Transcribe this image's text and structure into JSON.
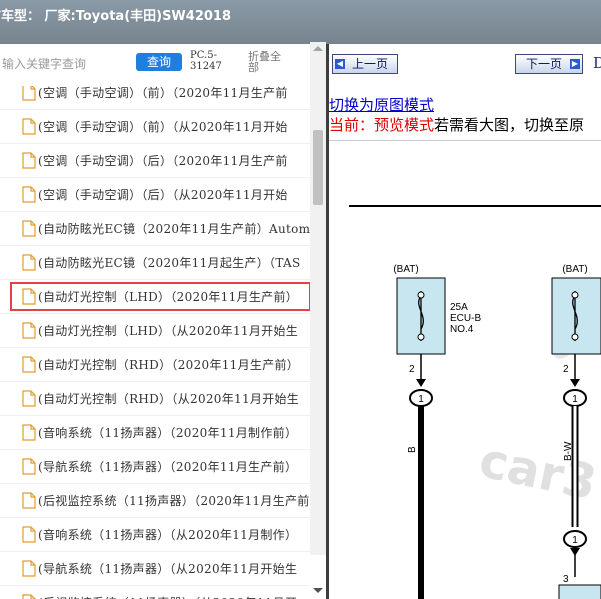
{
  "header": {
    "title": "前车型： 厂家:Toyota(丰田)SW42018"
  },
  "toolbar": {
    "search_placeholder": "输入关键字查询",
    "search_label": "查询",
    "pc_label": "PC.5-31247",
    "collapse_label": "折叠全部"
  },
  "tree": {
    "items": [
      {
        "label": "(空调（手动空调）（前）（2020年11月生产前"
      },
      {
        "label": "(空调（手动空调）（前）（从2020年11月开始"
      },
      {
        "label": "(空调（手动空调）（后）（2020年11月生产前"
      },
      {
        "label": "(空调（手动空调）（后）（从2020年11月开始"
      },
      {
        "label": "(自动防眩光EC镜（2020年11月生产前）Autom"
      },
      {
        "label": "(自动防眩光EC镜（2020年11月起生产）（TAS"
      },
      {
        "label": "(自动灯光控制（LHD）（2020年11月生产前）"
      },
      {
        "label": "(自动灯光控制（LHD）（从2020年11月开始生"
      },
      {
        "label": "(自动灯光控制（RHD）（2020年11月生产前）"
      },
      {
        "label": "(自动灯光控制（RHD）（从2020年11月开始生"
      },
      {
        "label": "(音响系统（11扬声器）（2020年11月制作前）"
      },
      {
        "label": "(导航系统（11扬声器）（2020年11月生产前）"
      },
      {
        "label": "(后视监控系统（11扬声器）（2020年11月生产前"
      },
      {
        "label": "(音响系统（11扬声器）（从2020年11月制作）"
      },
      {
        "label": "(导航系统（11扬声器）（从2020年11月开始生"
      },
      {
        "label": "(后视监控系统（11扬声器）（从2020年11月开"
      }
    ],
    "selected_index": 6
  },
  "nav": {
    "prev_label": "上一页",
    "next_label": "下一页",
    "edge_glyph": "D"
  },
  "mode": {
    "link_text": "切换为原图模式",
    "current_prefix": "当前：",
    "current_mode": "预览模式",
    "hint": "若需看大图，切换至原"
  },
  "diagram": {
    "left_source": "(BAT)",
    "right_source": "(BAT)",
    "fuse_label_1": "25A",
    "fuse_label_2": "ECU-B",
    "fuse_label_3": "NO.4",
    "pin_left": "2",
    "pin_right": "2",
    "connector_left": "1",
    "connector_right": "1",
    "connector_right_2": "1",
    "wire_left": "B",
    "wire_right": "B-W",
    "pin_bottom": "3",
    "watermark": "car3",
    "watermark_top": "ca"
  },
  "colors": {
    "titlebar": "#7f8e99",
    "search_button": "#1f7fe0",
    "selection_border": "#e0434a",
    "fuse_fill": "#c8e6f0",
    "link": "#0000cc",
    "mode_red": "#e00000"
  }
}
